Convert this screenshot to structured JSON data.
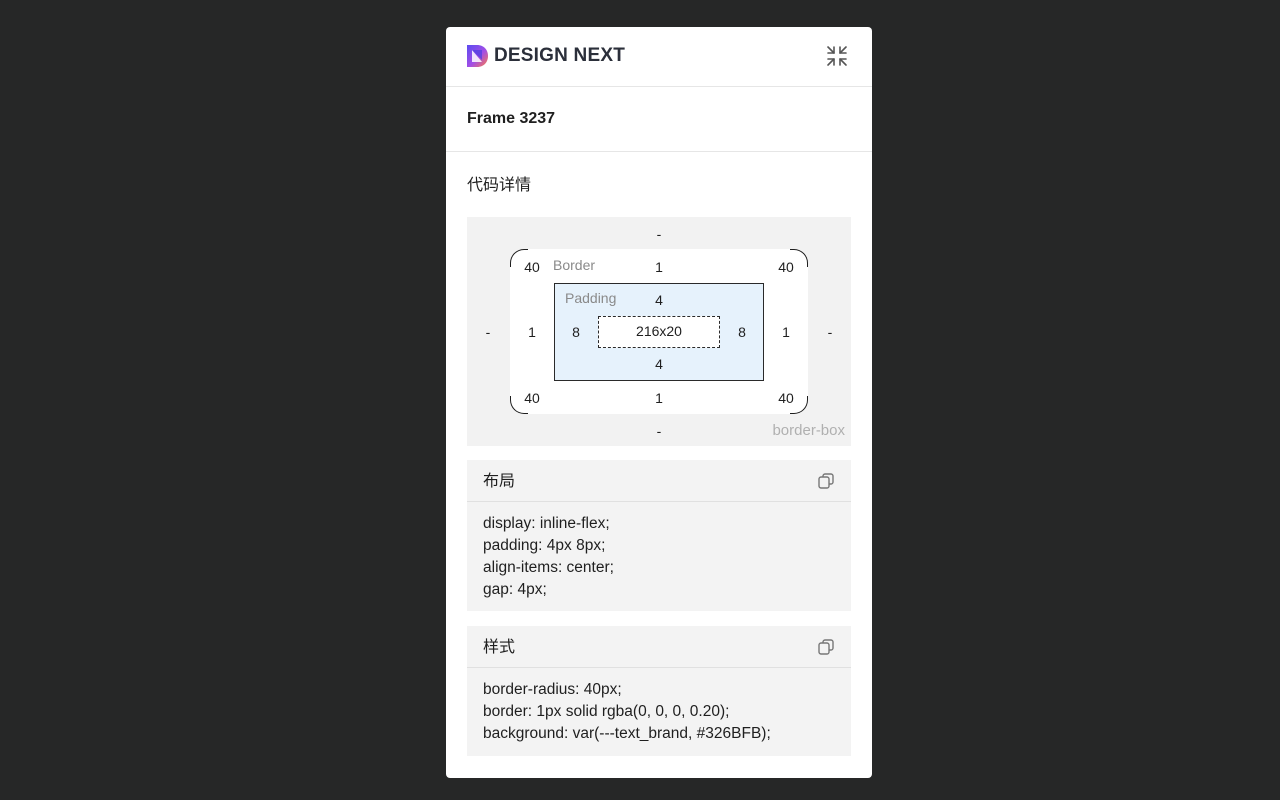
{
  "header": {
    "brand": "DESIGN NEXT",
    "logo_icon": "design-next-logo-icon",
    "collapse_icon": "collapse-icon"
  },
  "frame": {
    "name": "Frame 3237"
  },
  "details": {
    "title": "代码详情"
  },
  "box_model": {
    "margin": {
      "top": "-",
      "right": "-",
      "bottom": "-",
      "left": "-"
    },
    "border_label": "Border",
    "border": {
      "top": "1",
      "right": "1",
      "bottom": "1",
      "left": "1"
    },
    "radius": {
      "top_left": "40",
      "top_right": "40",
      "bottom_left": "40",
      "bottom_right": "40"
    },
    "padding_label": "Padding",
    "padding": {
      "top": "4",
      "right": "8",
      "bottom": "4",
      "left": "8"
    },
    "content": "216x20",
    "box_sizing": "border-box"
  },
  "layout": {
    "title": "布局",
    "copy_icon": "copy-icon",
    "lines": [
      "display: inline-flex;",
      "padding: 4px 8px;",
      "align-items: center;",
      "gap: 4px;"
    ]
  },
  "style": {
    "title": "样式",
    "copy_icon": "copy-icon",
    "lines": [
      "border-radius: 40px;",
      "border: 1px solid rgba(0, 0, 0, 0.20);",
      "background: var(---text_brand, #326BFB);"
    ]
  },
  "colors": {
    "background": "#262727",
    "panel": "#ffffff",
    "padding_box": "#e6f2fc",
    "logo_purple": "#6a4cf0",
    "logo_orange": "#ff7a45"
  }
}
